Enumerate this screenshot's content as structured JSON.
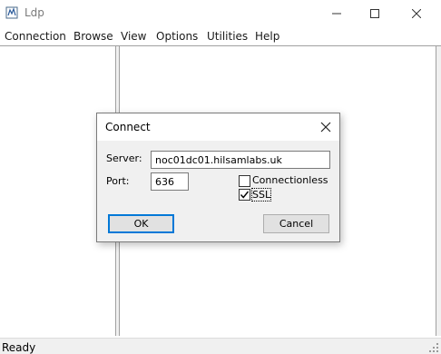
{
  "window": {
    "title": "Ldp",
    "icon": "ldp-app-icon",
    "controls": [
      "minimize-icon",
      "maximize-icon",
      "close-icon"
    ]
  },
  "menu": [
    {
      "label": "Connection"
    },
    {
      "label": "Browse"
    },
    {
      "label": "View"
    },
    {
      "label": "Options"
    },
    {
      "label": "Utilities"
    },
    {
      "label": "Help"
    }
  ],
  "statusbar": {
    "text": "Ready"
  },
  "dialog": {
    "title": "Connect",
    "server_label": "Server:",
    "server_value": "noc01dc01.hilsamlabs.uk",
    "port_label": "Port:",
    "port_value": "636",
    "connectionless_label": "Connectionless",
    "connectionless_checked": false,
    "ssl_label": "SSL",
    "ssl_checked": true,
    "ok_label": "OK",
    "cancel_label": "Cancel"
  },
  "colors": {
    "accent": "#0078d7",
    "dialog_bg": "#f0f0f0",
    "button_bg": "#e1e1e1"
  }
}
